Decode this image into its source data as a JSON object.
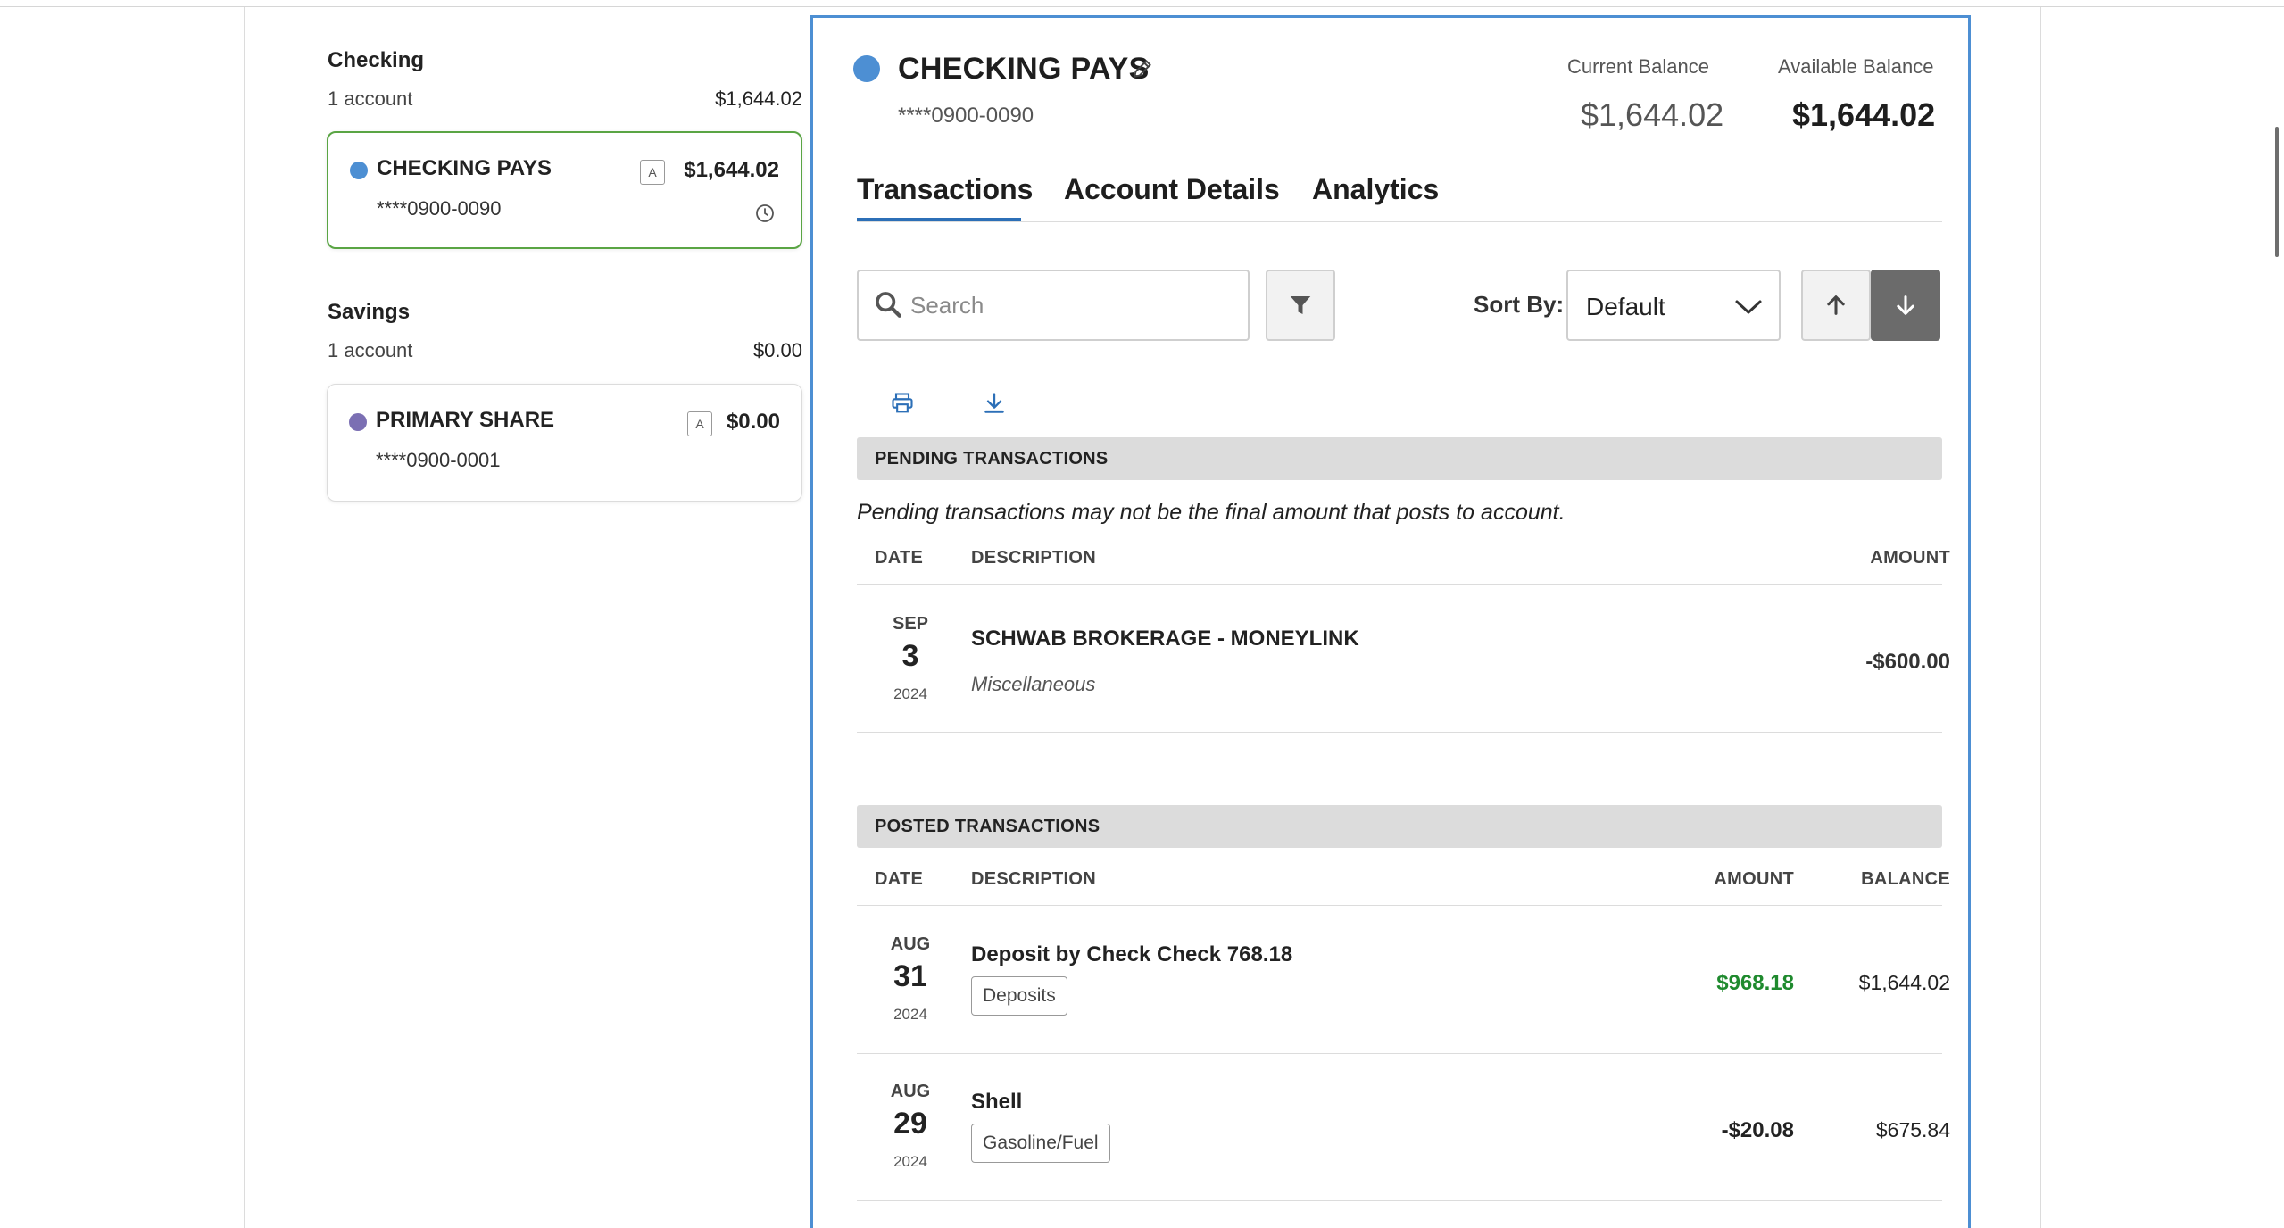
{
  "colors": {
    "accent_blue": "#4d8fd3",
    "tab_underline": "#2c6fb7",
    "active_card_border": "#5aa544",
    "savings_dot": "#7b6fb3",
    "deposit_green": "#1f8a2e"
  },
  "sidebar": {
    "groups": [
      {
        "title": "Checking",
        "count": "1 account",
        "total": "$1,644.02",
        "account": {
          "name": "CHECKING PAYS",
          "number": "****0900-0090",
          "badge": "A",
          "amount": "$1,644.02",
          "status_icon": "clock-icon"
        }
      },
      {
        "title": "Savings",
        "count": "1 account",
        "total": "$0.00",
        "account": {
          "name": "PRIMARY SHARE",
          "number": "****0900-0001",
          "badge": "A",
          "amount": "$0.00"
        }
      }
    ]
  },
  "account": {
    "name": "CHECKING PAYS",
    "number": "****0900-0090",
    "current_balance_label": "Current Balance",
    "current_balance": "$1,644.02",
    "available_balance_label": "Available Balance",
    "available_balance": "$1,644.02"
  },
  "tabs": [
    {
      "label": "Transactions",
      "active": true
    },
    {
      "label": "Account Details",
      "active": false
    },
    {
      "label": "Analytics",
      "active": false
    }
  ],
  "toolbar": {
    "search_placeholder": "Search",
    "sort_label": "Sort By:",
    "sort_value": "Default"
  },
  "pending": {
    "header": "PENDING TRANSACTIONS",
    "note": "Pending transactions may not be the final amount that posts to account.",
    "columns": {
      "date": "DATE",
      "description": "DESCRIPTION",
      "amount": "AMOUNT"
    },
    "rows": [
      {
        "month": "SEP",
        "day": "3",
        "year": "2024",
        "description": "SCHWAB BROKERAGE - MONEYLINK",
        "category": "Miscellaneous",
        "amount": "-$600.00"
      }
    ]
  },
  "posted": {
    "header": "POSTED TRANSACTIONS",
    "columns": {
      "date": "DATE",
      "description": "DESCRIPTION",
      "amount": "AMOUNT",
      "balance": "BALANCE"
    },
    "rows": [
      {
        "month": "AUG",
        "day": "31",
        "year": "2024",
        "description": "Deposit by Check Check 768.18",
        "category": "Deposits",
        "amount": "$968.18",
        "balance": "$1,644.02"
      },
      {
        "month": "AUG",
        "day": "29",
        "year": "2024",
        "description": "Shell",
        "category": "Gasoline/Fuel",
        "amount": "-$20.08",
        "balance": "$675.84"
      }
    ]
  }
}
